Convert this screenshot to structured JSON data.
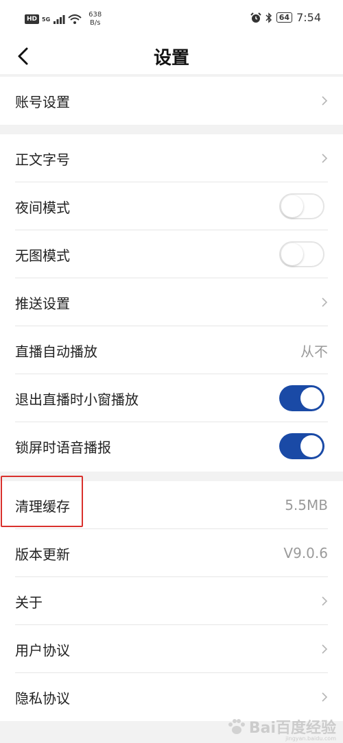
{
  "status": {
    "hd": "HD",
    "net": "5G",
    "speed_value": "638",
    "speed_unit": "B/s",
    "battery": "64",
    "time": "7:54"
  },
  "nav": {
    "title": "设置"
  },
  "groups": {
    "account": {
      "label": "账号设置"
    },
    "display": {
      "font_size": "正文字号",
      "night_mode": "夜间模式",
      "no_image_mode": "无图模式",
      "push_settings": "推送设置",
      "live_autoplay": "直播自动播放",
      "live_autoplay_value": "从不",
      "live_pip": "退出直播时小窗播放",
      "lockscreen_voice": "锁屏时语音播报"
    },
    "misc": {
      "clear_cache": "清理缓存",
      "clear_cache_value": "5.5MB",
      "version_update": "版本更新",
      "version_value": "V9.0.6",
      "about": "关于",
      "user_agreement": "用户协议",
      "privacy_agreement": "隐私协议"
    }
  },
  "toggles": {
    "night_mode": false,
    "no_image_mode": false,
    "live_pip": true,
    "lockscreen_voice": true
  },
  "watermark": {
    "brand": "Bai百度经验",
    "url": "jingyan.baidu.com"
  },
  "colors": {
    "accent": "#1a4aa6",
    "highlight": "#d9302c",
    "secondary_text": "#9a9a9a"
  }
}
